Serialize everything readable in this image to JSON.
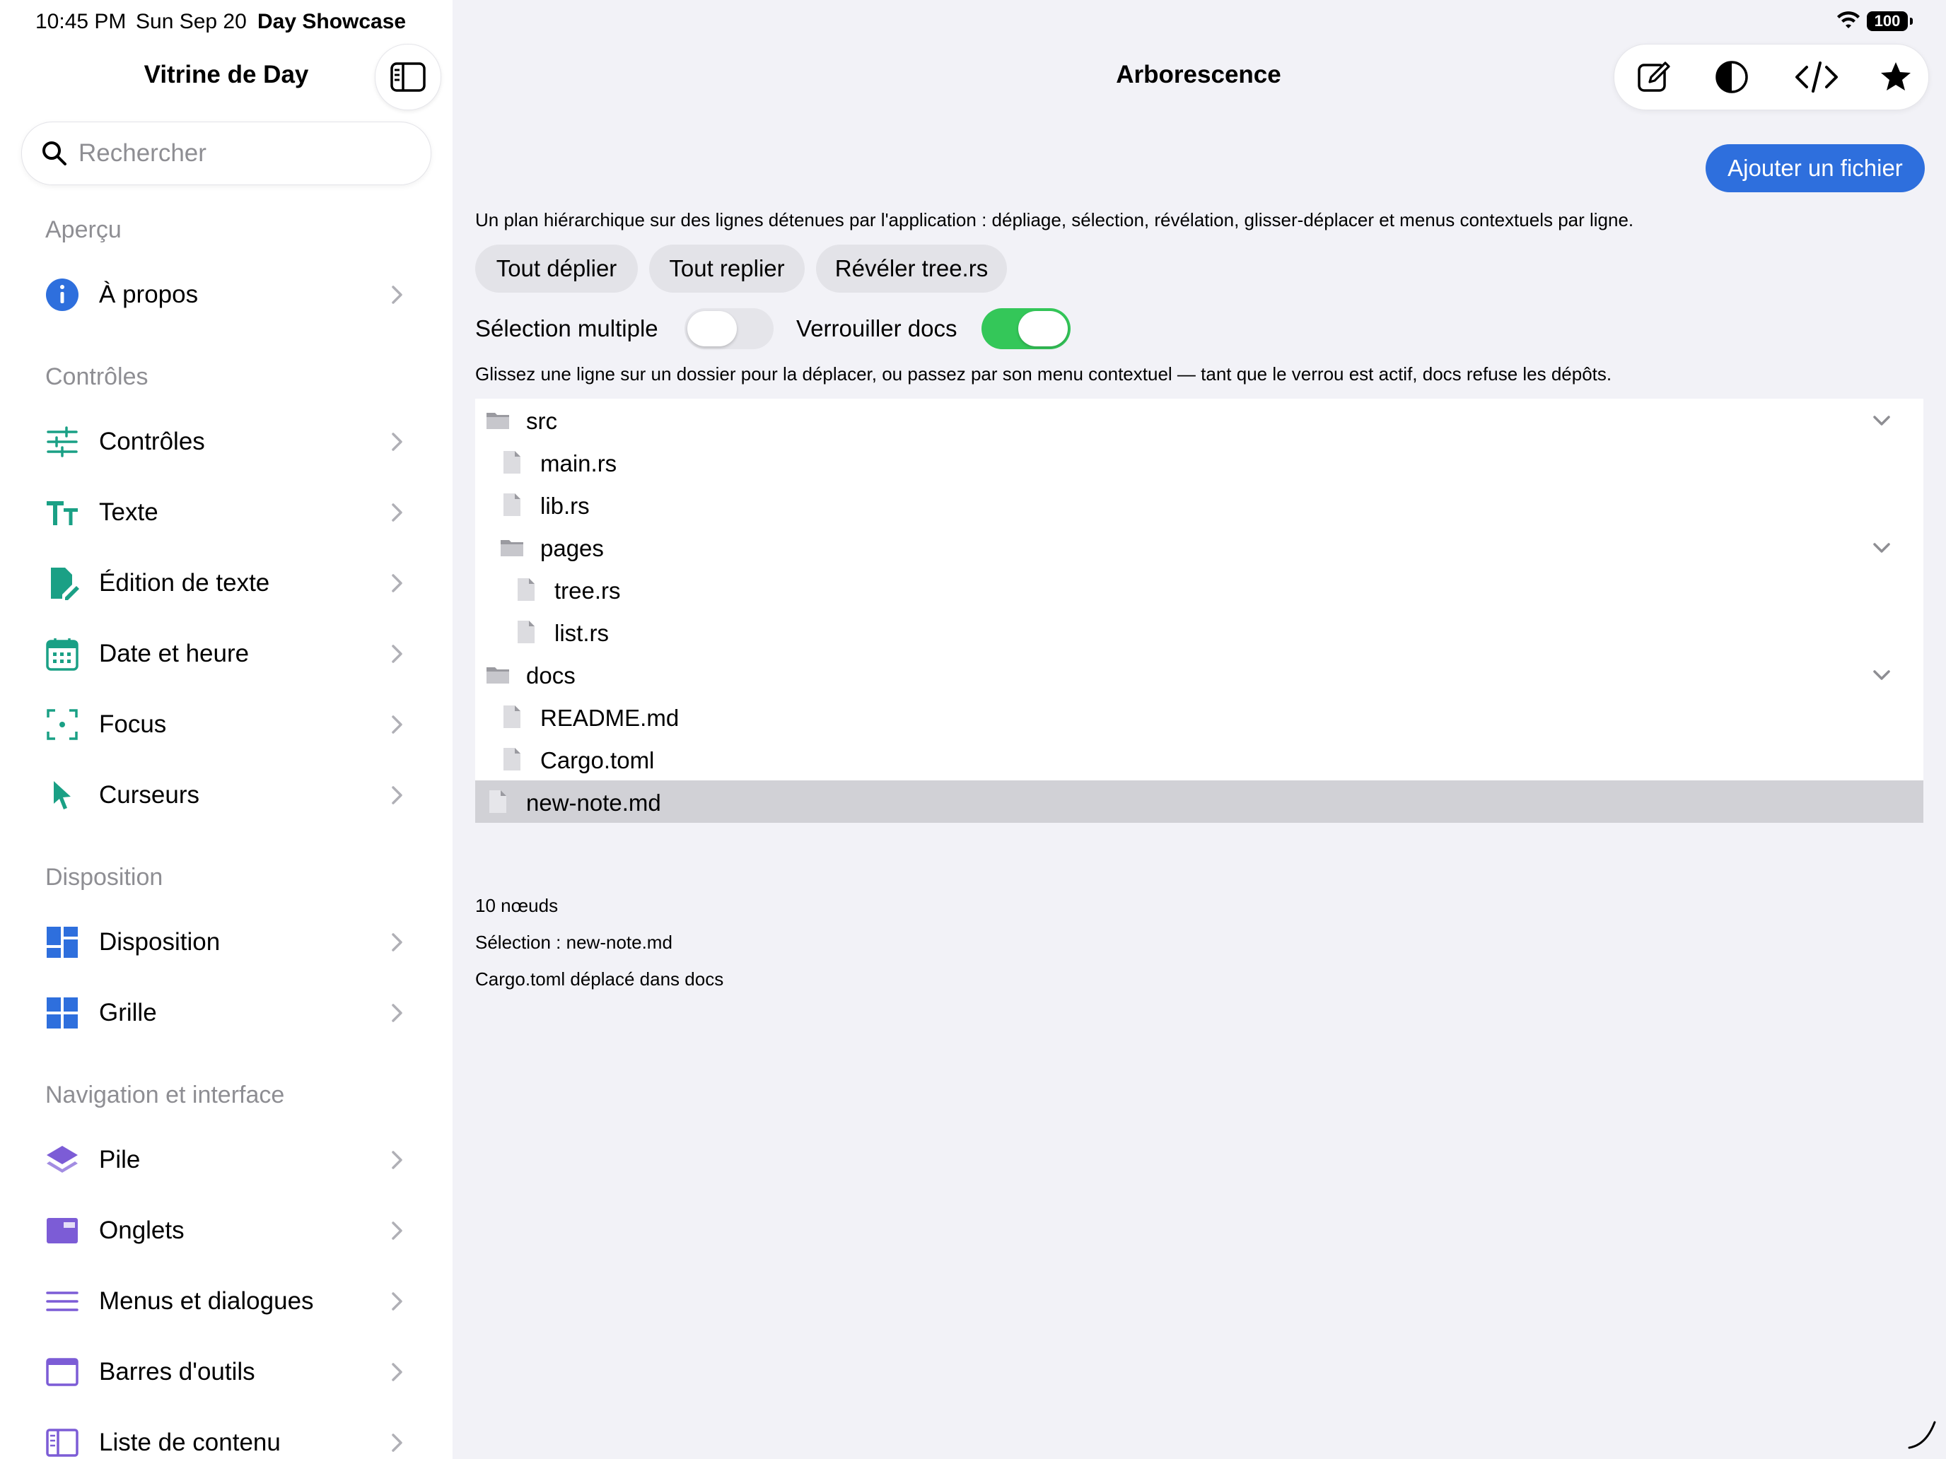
{
  "status_bar": {
    "time": "10:45 PM",
    "date": "Sun Sep 20",
    "app_name": "Day Showcase",
    "battery": "100"
  },
  "sidebar": {
    "title": "Vitrine de Day",
    "search_placeholder": "Rechercher",
    "sections": [
      {
        "title": "Aperçu",
        "items": [
          {
            "label": "À propos",
            "icon": "info-icon",
            "color": "#2e6fdd"
          }
        ]
      },
      {
        "title": "Contrôles",
        "items": [
          {
            "label": "Contrôles",
            "icon": "sliders-icon",
            "color": "#1aa085"
          },
          {
            "label": "Texte",
            "icon": "text-size-icon",
            "color": "#1aa085"
          },
          {
            "label": "Édition de texte",
            "icon": "document-edit-icon",
            "color": "#1aa085"
          },
          {
            "label": "Date et heure",
            "icon": "calendar-icon",
            "color": "#1aa085"
          },
          {
            "label": "Focus",
            "icon": "focus-icon",
            "color": "#1aa085"
          },
          {
            "label": "Curseurs",
            "icon": "pointer-icon",
            "color": "#1aa085"
          }
        ]
      },
      {
        "title": "Disposition",
        "items": [
          {
            "label": "Disposition",
            "icon": "layout-icon",
            "color": "#2e6fdd"
          },
          {
            "label": "Grille",
            "icon": "grid-icon",
            "color": "#2e6fdd"
          }
        ]
      },
      {
        "title": "Navigation et interface",
        "items": [
          {
            "label": "Pile",
            "icon": "stack-icon",
            "color": "#7c5cd6"
          },
          {
            "label": "Onglets",
            "icon": "tabs-icon",
            "color": "#7c5cd6"
          },
          {
            "label": "Menus et dialogues",
            "icon": "menu-lines-icon",
            "color": "#7c5cd6"
          },
          {
            "label": "Barres d'outils",
            "icon": "toolbar-window-icon",
            "color": "#7c5cd6"
          },
          {
            "label": "Liste de contenu",
            "icon": "split-view-icon",
            "color": "#7c5cd6"
          }
        ]
      }
    ]
  },
  "main": {
    "title": "Arborescence",
    "toolbar_icons": [
      "compose-icon",
      "contrast-icon",
      "code-icon",
      "star-icon"
    ],
    "add_button": "Ajouter un fichier",
    "description": "Un plan hiérarchique sur des lignes détenues par l'application : dépliage, sélection, révélation, glisser-déplacer et menus contextuels par ligne.",
    "actions": [
      "Tout déplier",
      "Tout replier",
      "Révéler tree.rs"
    ],
    "toggles": [
      {
        "label": "Sélection multiple",
        "on": false
      },
      {
        "label": "Verrouiller docs",
        "on": true
      }
    ],
    "hint": "Glissez une ligne sur un dossier pour la déplacer, ou passez par son menu contextuel — tant que le verrou est actif, docs refuse les dépôts.",
    "tree": [
      {
        "name": "src",
        "type": "folder",
        "depth": 0,
        "expanded": true
      },
      {
        "name": "main.rs",
        "type": "file",
        "depth": 1
      },
      {
        "name": "lib.rs",
        "type": "file",
        "depth": 1
      },
      {
        "name": "pages",
        "type": "folder",
        "depth": 1,
        "expanded": true
      },
      {
        "name": "tree.rs",
        "type": "file",
        "depth": 2
      },
      {
        "name": "list.rs",
        "type": "file",
        "depth": 2
      },
      {
        "name": "docs",
        "type": "folder",
        "depth": 0,
        "expanded": true
      },
      {
        "name": "README.md",
        "type": "file",
        "depth": 1
      },
      {
        "name": "Cargo.toml",
        "type": "file",
        "depth": 1
      },
      {
        "name": "new-note.md",
        "type": "file",
        "depth": 0,
        "selected": true
      }
    ],
    "footer": {
      "node_count": "10 nœuds",
      "selection": "Sélection : new-note.md",
      "last_action": "Cargo.toml déplacé dans docs"
    }
  },
  "colors": {
    "accent": "#2e6fdd",
    "toggle_on": "#34c759",
    "toggle_off": "#e5e5ea",
    "selected_row": "#d1d1d6"
  }
}
